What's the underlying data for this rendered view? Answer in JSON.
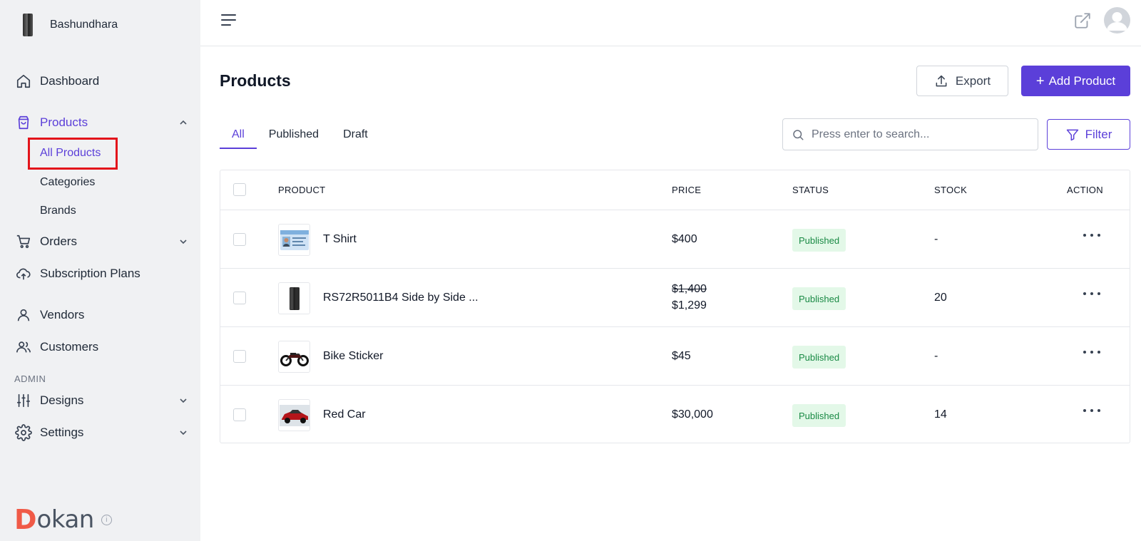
{
  "store": {
    "name": "Bashundhara"
  },
  "sidebar": {
    "items": [
      {
        "label": "Dashboard",
        "icon": "home-icon"
      },
      {
        "label": "Products",
        "icon": "shopping-bag-icon"
      },
      {
        "label": "Orders",
        "icon": "cart-icon"
      },
      {
        "label": "Subscription Plans",
        "icon": "cloud-upload-icon"
      },
      {
        "label": "Vendors",
        "icon": "user-icon"
      },
      {
        "label": "Customers",
        "icon": "users-icon"
      },
      {
        "label": "Designs",
        "icon": "sliders-icon"
      },
      {
        "label": "Settings",
        "icon": "gear-icon"
      }
    ],
    "products_sub": [
      "All Products",
      "Categories",
      "Brands"
    ],
    "admin_label": "ADMIN"
  },
  "logo": {
    "first_letter": "D",
    "rest": "okan",
    "info": "i"
  },
  "page": {
    "title": "Products",
    "export_label": "Export",
    "add_label": "Add Product",
    "add_prefix": "+"
  },
  "tabs": [
    "All",
    "Published",
    "Draft"
  ],
  "search": {
    "placeholder": "Press enter to search..."
  },
  "filter_label": "Filter",
  "table": {
    "headers": [
      "PRODUCT",
      "PRICE",
      "STATUS",
      "STOCK",
      "ACTION"
    ],
    "rows": [
      {
        "name": "T Shirt",
        "price": "$400",
        "old_price": "",
        "status": "Published",
        "stock": "-"
      },
      {
        "name": "RS72R5011B4 Side by Side ...",
        "price": "$1,299",
        "old_price": "$1,400",
        "status": "Published",
        "stock": "20"
      },
      {
        "name": "Bike Sticker",
        "price": "$45",
        "old_price": "",
        "status": "Published",
        "stock": "-"
      },
      {
        "name": "Red Car",
        "price": "$30,000",
        "old_price": "",
        "status": "Published",
        "stock": "14"
      }
    ]
  },
  "colors": {
    "accent": "#5b3fd9",
    "sidebar_bg": "#f0f1f3",
    "badge_bg": "#e3f8e8",
    "badge_text": "#1a8a45",
    "logo_d": "#f05a47",
    "highlight": "#e3141b"
  }
}
